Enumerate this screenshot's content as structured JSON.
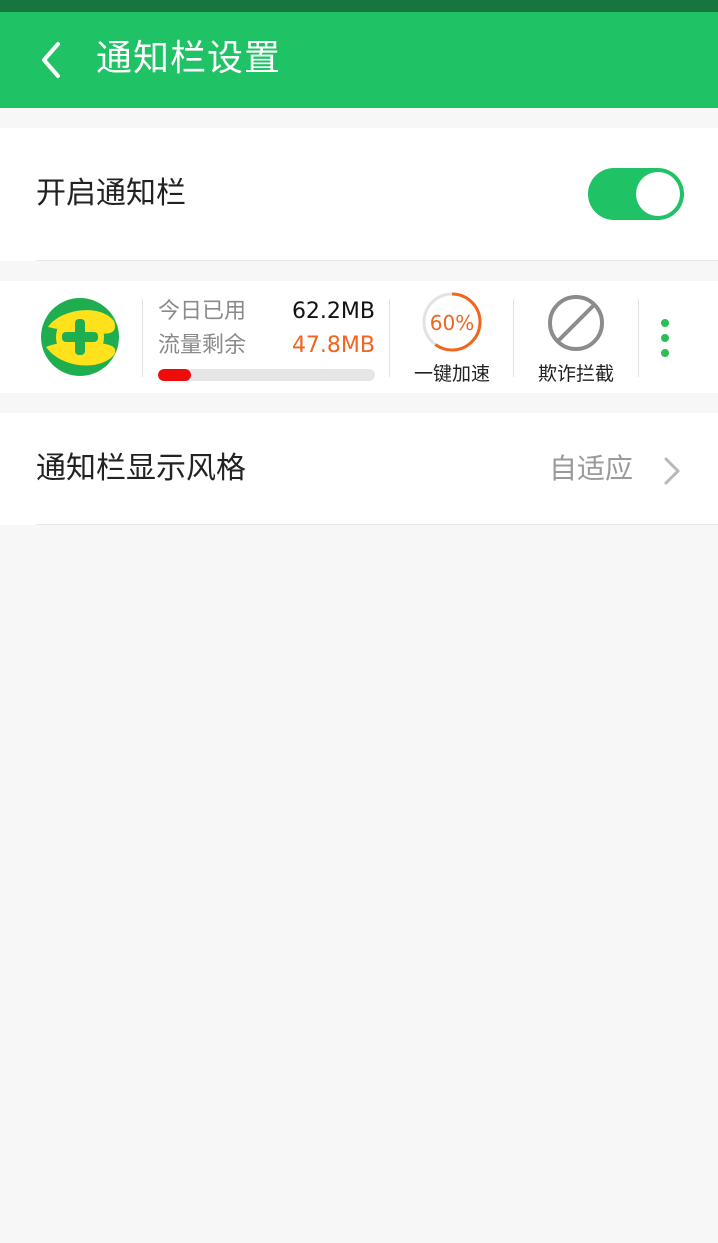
{
  "header": {
    "title": "通知栏设置"
  },
  "notification_toggle": {
    "label": "开启通知栏",
    "enabled": true
  },
  "preview": {
    "today_used_label": "今日已用",
    "today_used_value": "62.2MB",
    "remaining_label": "流量剩余",
    "remaining_value": "47.8MB",
    "usage_fraction": 0.15,
    "speedup_percent": "60%",
    "speedup_fraction": 0.6,
    "speedup_label": "一键加速",
    "fraud_block_label": "欺诈拦截"
  },
  "display_style": {
    "label": "通知栏显示风格",
    "value": "自适应"
  },
  "colors": {
    "brand_green": "#1fc264",
    "status_bar": "#17753f",
    "warning_orange": "#f0651f",
    "usage_red": "#ee0b0b"
  },
  "icons": [
    "back-arrow-icon",
    "app-logo-icon",
    "speedup-gauge-icon",
    "block-icon",
    "more-vertical-icon",
    "chevron-right-icon"
  ]
}
